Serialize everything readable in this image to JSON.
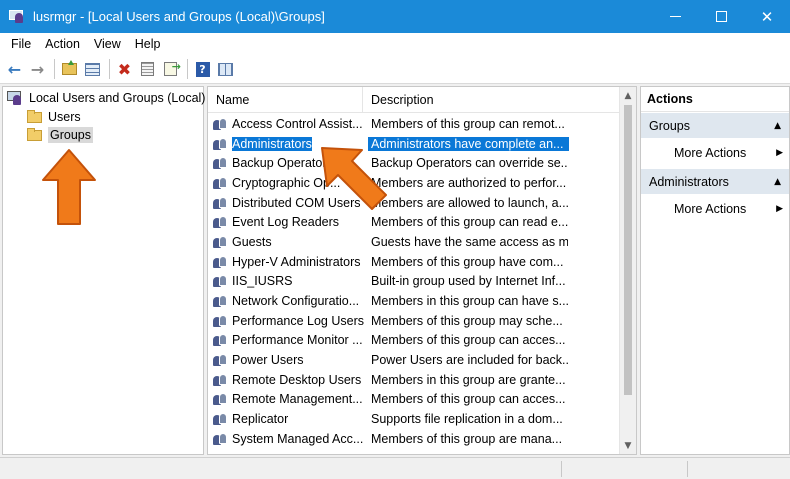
{
  "window": {
    "title": "lusrmgr - [Local Users and Groups (Local)\\Groups]",
    "minimize": "",
    "maximize": "",
    "close": "✕"
  },
  "menu": [
    "File",
    "Action",
    "View",
    "Help"
  ],
  "toolbar": {
    "back_icon": "arrow-left-icon",
    "forward_icon": "arrow-right-icon",
    "help_label": "?"
  },
  "tree": {
    "root": "Local Users and Groups (Local)",
    "items": [
      {
        "label": "Users",
        "selected": false
      },
      {
        "label": "Groups",
        "selected": true
      }
    ]
  },
  "list": {
    "columns": {
      "name": "Name",
      "description": "Description"
    },
    "rows": [
      {
        "name": "Access Control Assist...",
        "description": "Members of this group can remot..."
      },
      {
        "name": "Administrators",
        "description": "Administrators have complete an...",
        "highlighted": true
      },
      {
        "name": "Backup Operators",
        "description": "Backup Operators can override se..."
      },
      {
        "name": "Cryptographic Op...",
        "description": "Members are authorized to perfor..."
      },
      {
        "name": "Distributed COM Users",
        "description": "Members are allowed to launch, a..."
      },
      {
        "name": "Event Log Readers",
        "description": "Members of this group can read e..."
      },
      {
        "name": "Guests",
        "description": "Guests have the same access as m..."
      },
      {
        "name": "Hyper-V Administrators",
        "description": "Members of this group have com..."
      },
      {
        "name": "IIS_IUSRS",
        "description": "Built-in group used by Internet Inf..."
      },
      {
        "name": "Network Configuratio...",
        "description": "Members in this group can have s..."
      },
      {
        "name": "Performance Log Users",
        "description": "Members of this group may sche..."
      },
      {
        "name": "Performance Monitor ...",
        "description": "Members of this group can acces..."
      },
      {
        "name": "Power Users",
        "description": "Power Users are included for back..."
      },
      {
        "name": "Remote Desktop Users",
        "description": "Members in this group are grante..."
      },
      {
        "name": "Remote Management...",
        "description": "Members of this group can acces..."
      },
      {
        "name": "Replicator",
        "description": "Supports file replication in a dom..."
      },
      {
        "name": "System Managed Acc...",
        "description": "Members of this group are mana..."
      }
    ]
  },
  "actions": {
    "title": "Actions",
    "sections": [
      {
        "label": "Groups",
        "item": "More Actions"
      },
      {
        "label": "Administrators",
        "item": "More Actions"
      }
    ]
  },
  "colors": {
    "titlebar": "#1b8ad8",
    "selection": "#0a78d7",
    "annotation_arrow": "#f07a1a"
  }
}
